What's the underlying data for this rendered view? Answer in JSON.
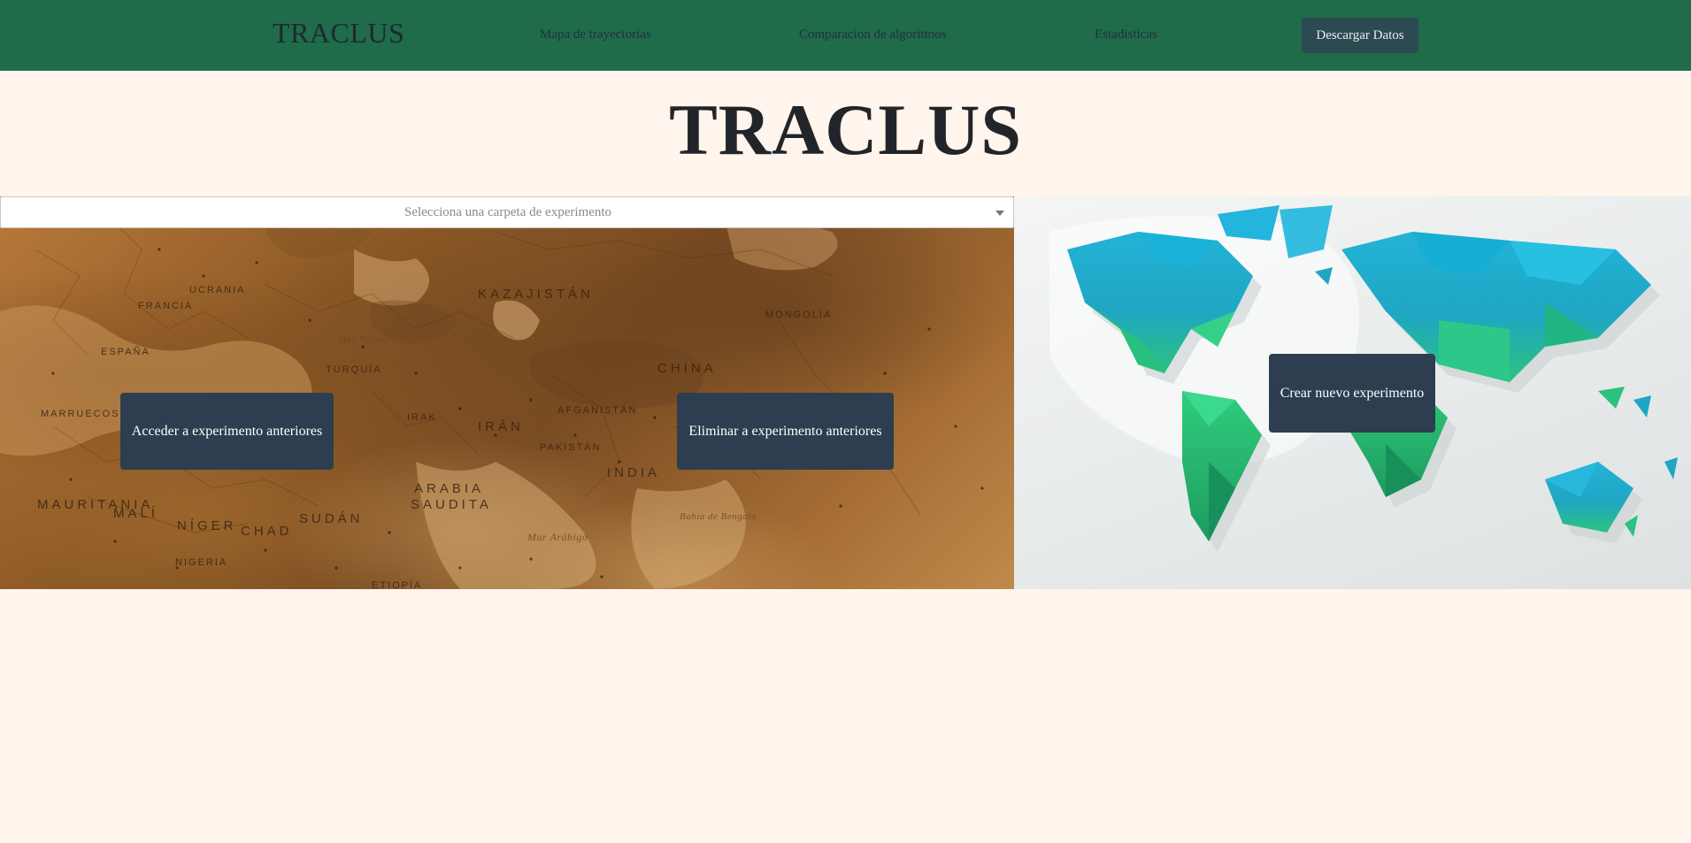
{
  "navbar": {
    "brand": "TRACLUS",
    "links": [
      {
        "label": "Mapa de trayectorias"
      },
      {
        "label": "Comparacion de algoritmos"
      },
      {
        "label": "Estadisticas"
      }
    ],
    "download_label": "Descargar Datos",
    "background_color": "#1f6b4a",
    "button_color": "#2c4a52"
  },
  "header": {
    "title": "TRACLUS"
  },
  "experiments": {
    "folder_select": {
      "placeholder": "Selecciona una carpeta de experimento",
      "icon": "chevron-down-icon"
    },
    "access_button": "Acceder a experimento anteriores",
    "delete_button": "Eliminar a experimento anteriores",
    "create_button": "Crear nuevo experimento",
    "button_color": "#2c3e50"
  },
  "left_map": {
    "image": "sepia-map-eurasia-africa",
    "labels": {
      "kazajistan": "KAZAJISTÁN",
      "mongolia": "MONGOLIA",
      "china": "CHINA",
      "iran": "IRÁN",
      "india": "INDIA",
      "arabia": "ARABIA",
      "saudita": "SAUDITA",
      "mauritania": "MAURITANIA",
      "mali": "MALÍ",
      "niger": "NÍGER",
      "chad": "CHAD",
      "sudan": "SUDÁN",
      "nigeria": "NIGERIA",
      "turquia": "TURQUÍA",
      "ucrania": "UCRANIA",
      "marruecos": "MARRUECOS",
      "pakistan": "PAKISTÁN",
      "afganistan": "AFGANISTÁN",
      "irak": "IRAK",
      "francia": "FRANCIA",
      "espana": "ESPAÑA",
      "mar_arabigo": "Mar Arábigo",
      "bahia_bengala": "Bahía de Bengala",
      "mar_negro": "Mar Negro",
      "etiopia": "ETIOPÍA"
    }
  },
  "right_map": {
    "image": "low-poly-world-map"
  }
}
